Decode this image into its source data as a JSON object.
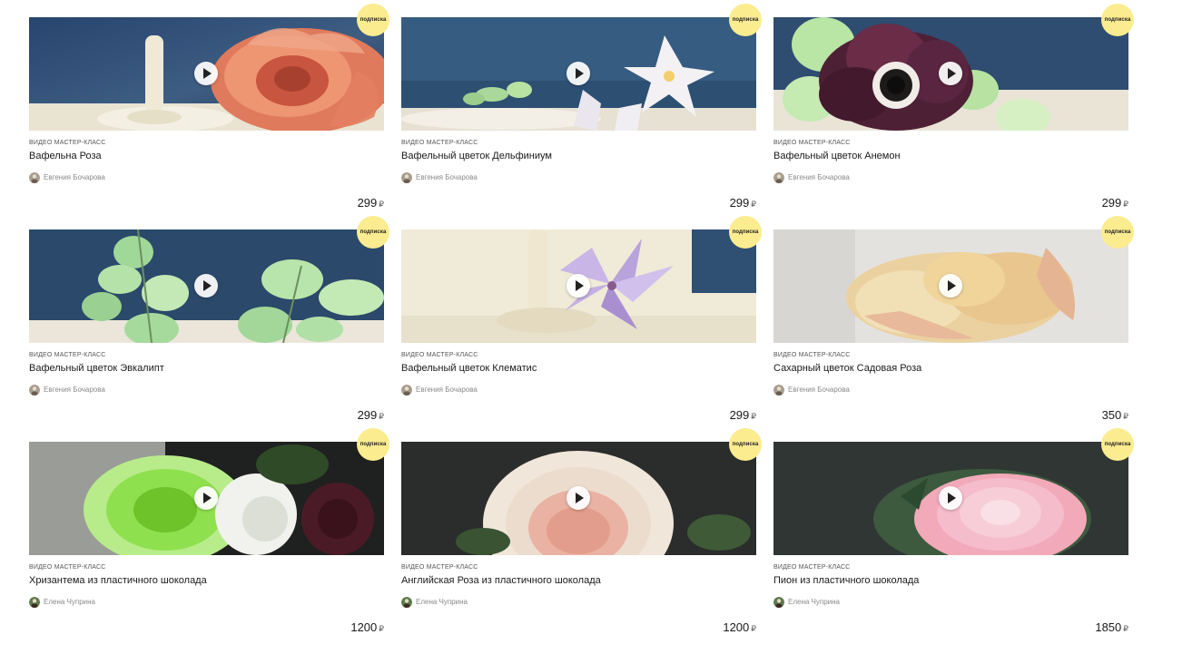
{
  "badge_label": "подписка",
  "kind_label": "Видео мастер-класс",
  "currency": "₽",
  "cards": [
    {
      "title": "Вафельна Роза",
      "author": "Евгения Бочарова",
      "price": "299"
    },
    {
      "title": "Вафельный цветок Дельфиниум",
      "author": "Евгения Бочарова",
      "price": "299"
    },
    {
      "title": "Вафельный цветок Анемон",
      "author": "Евгения Бочарова",
      "price": "299"
    },
    {
      "title": "Вафельный цветок Эвкалипт",
      "author": "Евгения Бочарова",
      "price": "299"
    },
    {
      "title": "Вафельный цветок Клематис",
      "author": "Евгения Бочарова",
      "price": "299"
    },
    {
      "title": "Сахарный цветок Садовая Роза",
      "author": "Евгения Бочарова",
      "price": "350"
    },
    {
      "title": "Хризантема из пластичного шоколада",
      "author": "Елена Чуприна",
      "price": "1200"
    },
    {
      "title": "Английская Роза из пластичного шоколада",
      "author": "Елена Чуприна",
      "price": "1200"
    },
    {
      "title": "Пион из пластичного шоколада",
      "author": "Елена Чуприна",
      "price": "1850"
    }
  ],
  "colors": {
    "badge": "#fbec8f",
    "text": "#1a1a1a",
    "muted": "#8a8a8a"
  }
}
